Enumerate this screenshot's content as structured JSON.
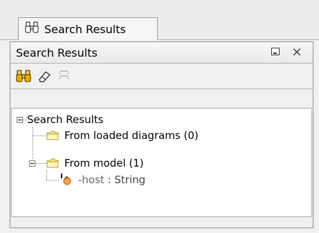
{
  "tab": {
    "label": "Search Results",
    "icon": "binoculars-icon"
  },
  "panel": {
    "title": "Search Results",
    "minimize_icon": "minimize-icon",
    "close_glyph": "×"
  },
  "toolbar": {
    "buttons": [
      {
        "name": "search",
        "icon": "binoculars-icon"
      },
      {
        "name": "clear",
        "icon": "eraser-icon"
      },
      {
        "name": "collapse",
        "icon": "dotted-grip-icon"
      }
    ]
  },
  "tree": {
    "root": {
      "label": "Search Results",
      "expanded": true
    },
    "children": [
      {
        "label": "From loaded diagrams (0)",
        "icon": "folder-icon"
      },
      {
        "label": "From model (1)",
        "icon": "folder-icon",
        "expanded": true,
        "children": [
          {
            "prefix": "-",
            "name": "host",
            "type_sep": " : ",
            "type": "String",
            "icon": "attribute-icon"
          }
        ]
      }
    ]
  },
  "colors": {
    "folder_fill": "#ffef8a",
    "folder_stroke": "#b59b2a",
    "attribute_icon": "#d2691e"
  }
}
